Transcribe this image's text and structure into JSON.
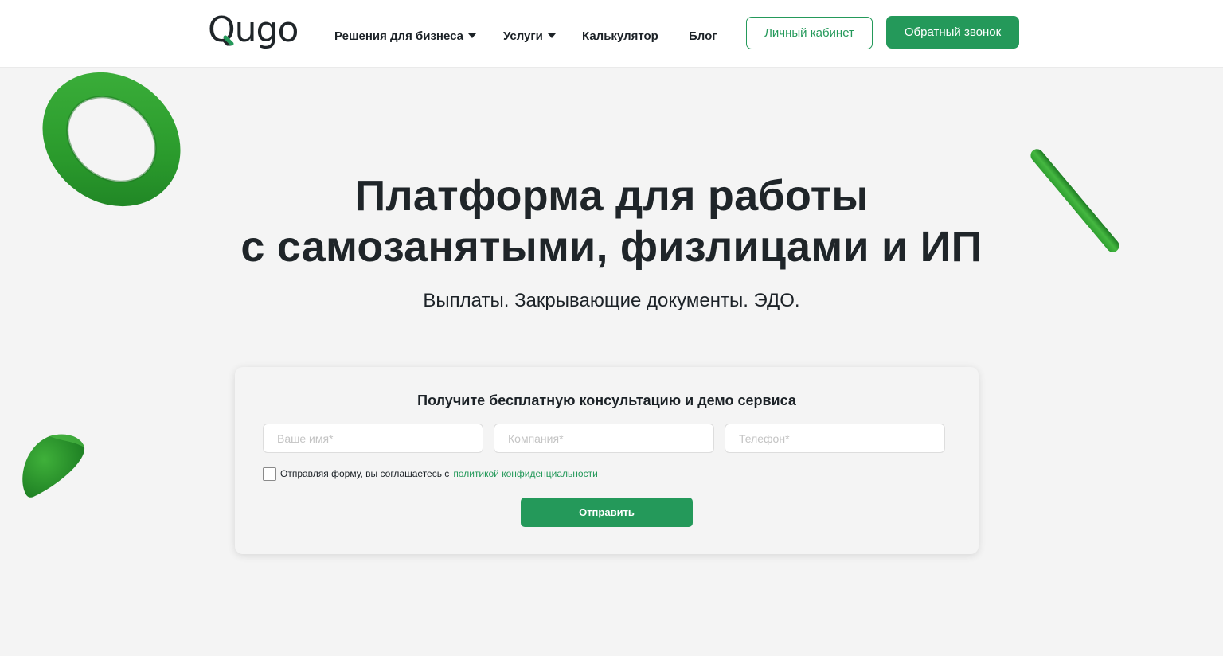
{
  "brand": {
    "logo_text": "Qugo",
    "accent_color": "#24995a",
    "text_color": "#1c2227"
  },
  "header": {
    "nav": [
      {
        "label": "Решения для бизнеса",
        "has_dropdown": true
      },
      {
        "label": "Услуги",
        "has_dropdown": true
      },
      {
        "label": "Калькулятор",
        "has_dropdown": false
      },
      {
        "label": "Блог",
        "has_dropdown": false
      }
    ],
    "cabinet_label": "Личный кабинет",
    "callback_label": "Обратный звонок"
  },
  "hero": {
    "title_line1": "Платформа для работы",
    "title_line2": "с самозанятыми, физлицами и ИП",
    "subtitle": "Выплаты. Закрывающие документы. ЭДО."
  },
  "form": {
    "title": "Получите бесплатную консультацию и демо сервиса",
    "fields": {
      "name_placeholder": "Ваше имя*",
      "company_placeholder": "Компания*",
      "phone_placeholder": "Телефон*"
    },
    "consent_text": "Отправляя форму, вы соглашаетесь с",
    "consent_link": "политикой конфиденциальности",
    "consent_checked": false,
    "submit_label": "Отправить"
  },
  "decorations": [
    "green-torus",
    "green-cylinder",
    "green-half-sphere"
  ]
}
